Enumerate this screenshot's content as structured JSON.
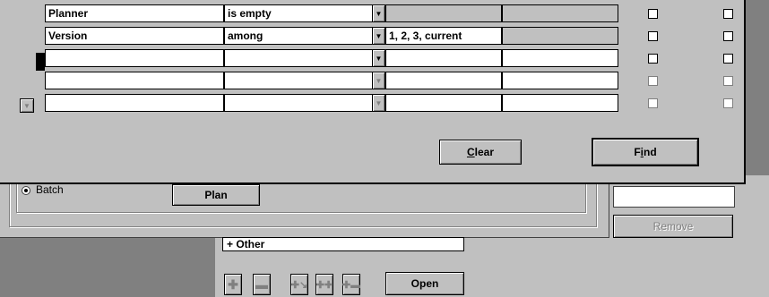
{
  "find_dialog": {
    "rows": [
      {
        "field": "Planner",
        "condition": "is empty",
        "value": "",
        "checked_a": false,
        "checked_b": false
      },
      {
        "field": "Version",
        "condition": "among",
        "value": "1, 2, 3, current",
        "checked_a": false,
        "checked_b": false
      },
      {
        "field": "",
        "condition": "",
        "value": "",
        "checked_a": false,
        "checked_b": false
      },
      {
        "field": "",
        "condition": "",
        "value": "",
        "checked_a": false,
        "checked_b": false
      },
      {
        "field": "",
        "condition": "",
        "value": "",
        "checked_a": false,
        "checked_b": false
      }
    ],
    "clear_label": "Clear",
    "clear_mnemonic": "C",
    "find_label": "Find",
    "find_mnemonic": "i"
  },
  "background_window": {
    "radio_label": "Batch",
    "plan_label": "Plan",
    "remove_label": "Remove",
    "tree_item": "+  Other",
    "open_label": "Open"
  },
  "icons": {
    "combo_arrow": "▼",
    "scroll_down": "▼",
    "tool_add": "+",
    "tool_remove": "−",
    "tool_expand": "expand-icon",
    "tool_add_all": "add-all-icon",
    "tool_remove_all": "remove-all-icon"
  }
}
